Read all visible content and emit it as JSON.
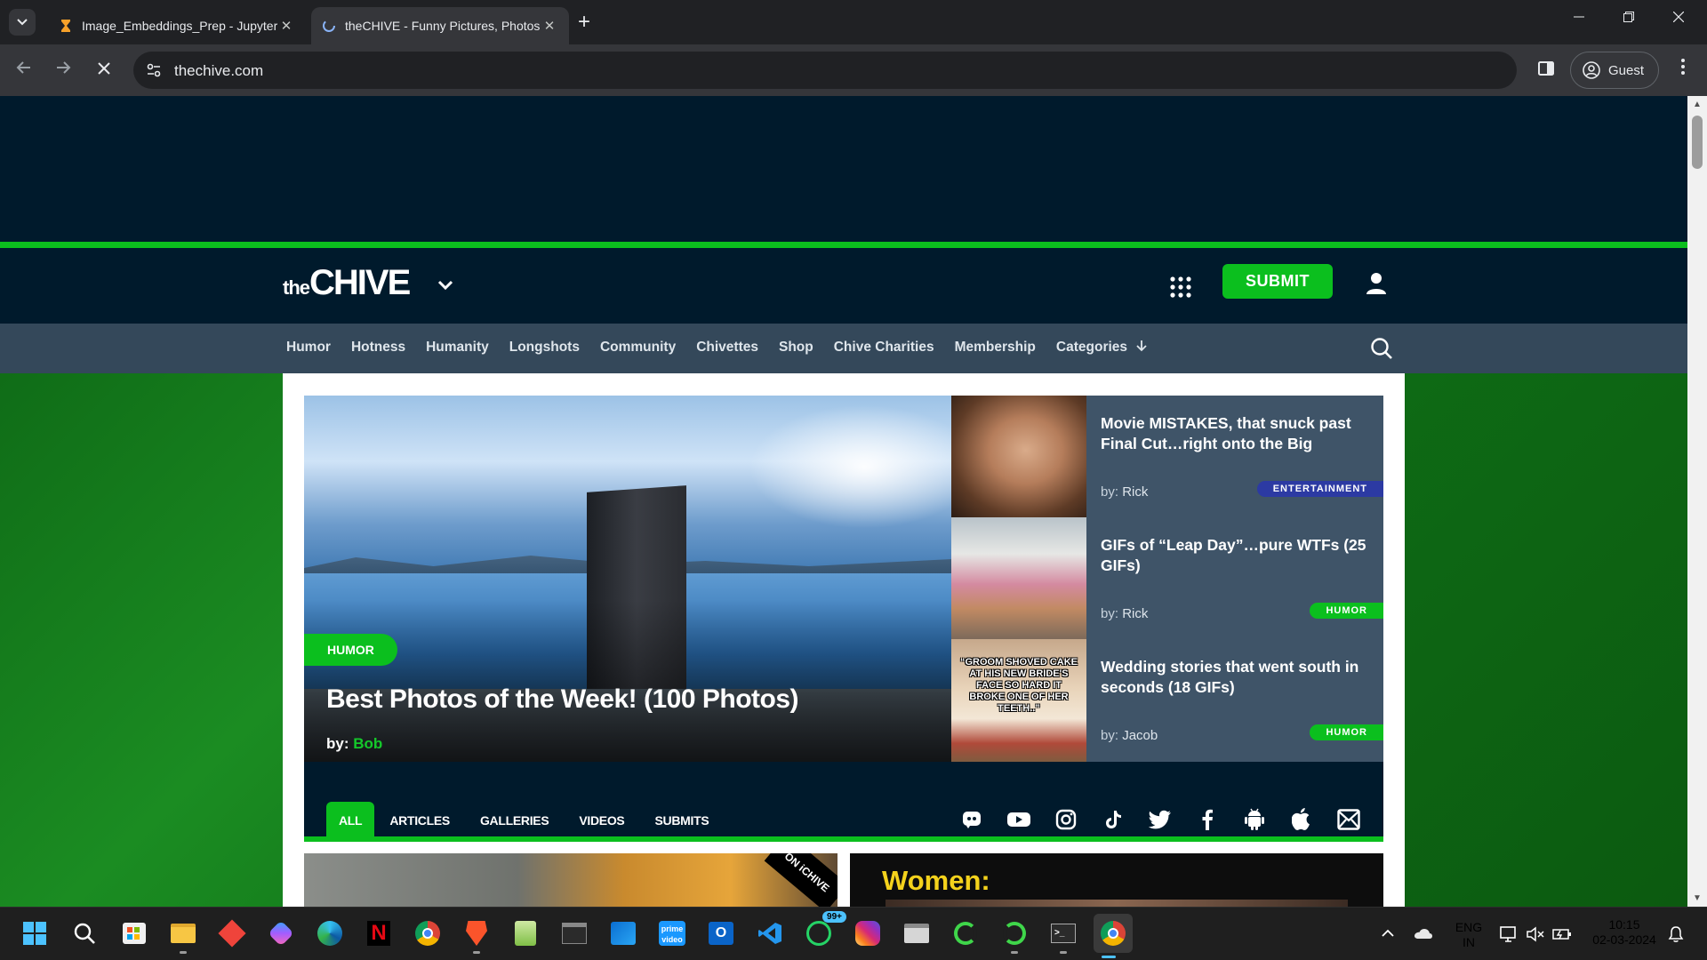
{
  "browser": {
    "tabs": [
      {
        "title": "Image_Embeddings_Prep - Jupyter",
        "favicon": "hourglass-icon",
        "close": "✕"
      },
      {
        "title": "theCHIVE - Funny Pictures, Photos",
        "favicon": "loading-icon",
        "close": "✕",
        "active": true
      }
    ],
    "new_tab": "+",
    "url": "thechive.com",
    "profile_label": "Guest"
  },
  "site": {
    "logo_the": "the",
    "logo_chive": "CHIVE",
    "submit_label": "SUBMIT",
    "nav": [
      "Humor",
      "Hotness",
      "Humanity",
      "Longshots",
      "Community",
      "Chivettes",
      "Shop",
      "Chive Charities",
      "Membership",
      "Categories"
    ],
    "hero": {
      "badge": "HUMOR",
      "title": "Best Photos of the Week! (100 Photos)",
      "by_prefix": "by:",
      "author": "Bob"
    },
    "side_posts": [
      {
        "title": "Movie MISTAKES, that snuck past Final Cut…right onto the Big",
        "by_prefix": "by:",
        "author": "Rick",
        "tag": "ENTERTAINMENT"
      },
      {
        "title": "GIFs of “Leap Day”…pure WTFs (25 GIFs)",
        "by_prefix": "by:",
        "author": "Rick",
        "tag": "HUMOR"
      },
      {
        "title": "Wedding stories that went south in seconds (18 GIFs)",
        "by_prefix": "by:",
        "author": "Jacob",
        "tag": "HUMOR",
        "thumb_caption": "“GROOM SHOVED CAKE AT HIS NEW BRIDE'S FACE SO HARD IT BROKE ONE OF HER TEETH..”"
      }
    ],
    "filters": [
      "ALL",
      "ARTICLES",
      "GALLERIES",
      "VIDEOS",
      "SUBMITS"
    ],
    "social_icons": [
      "discord-icon",
      "youtube-icon",
      "instagram-icon",
      "tiktok-icon",
      "twitter-icon",
      "facebook-icon",
      "android-icon",
      "apple-icon",
      "email-icon"
    ],
    "cards": [
      {
        "overlay": "ON iCHIVE"
      },
      {
        "title": "Women:"
      }
    ],
    "colors": {
      "brand_green": "#0bbf1e",
      "navy": "#001a2c",
      "nav_bg": "#34485a",
      "side_bg": "#3f5468",
      "ent_tag": "#2c3aa3"
    }
  },
  "taskbar": {
    "apps": [
      "windows-start-icon",
      "search-icon",
      "store-icon",
      "file-explorer-icon",
      "anydesk-icon",
      "copilot-icon",
      "edge-icon",
      "netflix-icon",
      "chrome-icon",
      "brave-icon",
      "notepad-icon",
      "terminal-icon",
      "windows-app-icon",
      "prime-video-icon",
      "outlook-icon",
      "vscode-icon",
      "whatsapp-icon",
      "instagram-icon",
      "window-icon",
      "spinner-icon",
      "spinner-icon",
      "cmd-icon",
      "chrome-active-icon"
    ],
    "whatsapp_badge": "99+",
    "lang_line1": "ENG",
    "lang_line2": "IN",
    "time": "10:15",
    "date": "02-03-2024"
  }
}
